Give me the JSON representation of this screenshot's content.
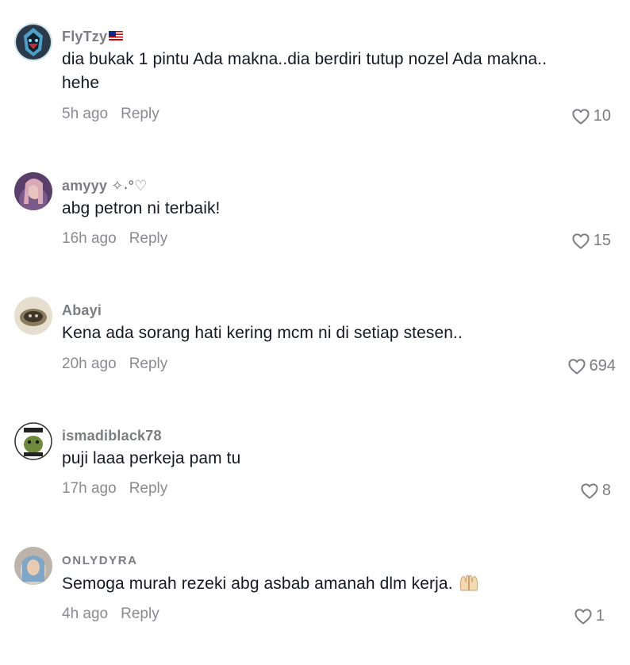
{
  "comments": [
    {
      "username": "FlyTzy",
      "text": "dia bukak 1 pintu Ada makna..dia berdiri tutup nozel Ada makna.. hehe",
      "time": "5h ago",
      "reply_label": "Reply",
      "likes": "10",
      "icons": [
        "malaysia-flag-icon",
        "heart-outline-icon"
      ]
    },
    {
      "username": "amyyy ✧˖°♡",
      "text": "abg petron ni terbaik!",
      "time": "16h ago",
      "reply_label": "Reply",
      "likes": "15"
    },
    {
      "username": "Abayi",
      "text": "Kena ada sorang hati kering mcm ni di setiap stesen..",
      "time": "20h ago",
      "reply_label": "Reply",
      "likes": "694"
    },
    {
      "username": "ismadiblack78",
      "text": "puji laaa perkeja pam tu",
      "time": "17h ago",
      "reply_label": "Reply",
      "likes": "8"
    },
    {
      "username": "ONLYDYRA",
      "text": "Semoga murah rezeki abg asbab amanah dlm kerja.",
      "time": "4h ago",
      "reply_label": "Reply",
      "likes": "1",
      "emoji": "raised-hands-icon"
    }
  ],
  "colors": {
    "text": "#161823",
    "muted": "#7c7d82",
    "background": "#ffffff"
  }
}
